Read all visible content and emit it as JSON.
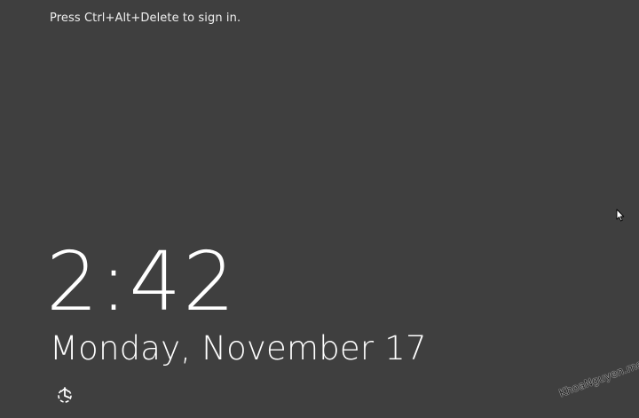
{
  "lock_screen": {
    "prompt": "Press Ctrl+Alt+Delete to sign in.",
    "time": "2:42",
    "date": "Monday, November 17",
    "ease_of_access_icon": "ease-of-access-icon",
    "cursor_icon": "mouse-pointer-icon"
  },
  "watermark": "KhoaNguyen.me",
  "colors": {
    "background": "#3f3f3f",
    "text": "#ffffff"
  }
}
